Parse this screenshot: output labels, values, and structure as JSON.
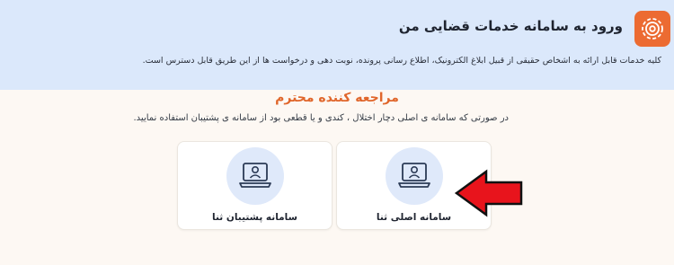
{
  "header": {
    "title": "ورود به سامانه خدمات قضایی من",
    "description": "کلیه خدمات قابل ارائه به اشخاص حقیقی از قبیل ابلاغ الکترونیک، اطلاع رسانی پرونده، نوبت دهی و درخواست ها از این طریق قابل دسترس است.",
    "icon": "settings-gear-icon",
    "accent_color": "#ec6b32"
  },
  "notice": {
    "title": "مراجعه کننده محترم",
    "text": "در صورتی که سامانه ی اصلی دچار اختلال ، کندی و یا قطعی بود از سامانه ی پشتیبان استفاده نمایید."
  },
  "cards": {
    "main": {
      "label": "سامانه اصلی ثنا",
      "icon": "laptop-user-icon"
    },
    "backup": {
      "label": "سامانه پشتیبان ثنا",
      "icon": "laptop-user-icon"
    }
  },
  "annotation": {
    "icon": "red-arrow-icon",
    "color": "#e8141c"
  }
}
